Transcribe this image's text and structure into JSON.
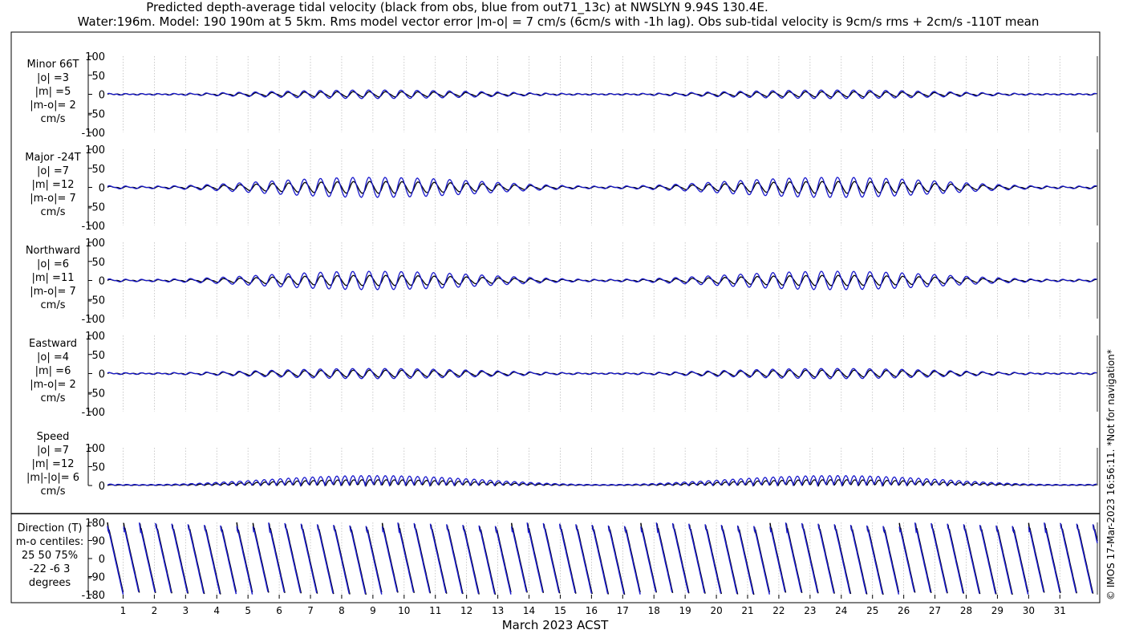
{
  "title": {
    "line1": "Predicted depth-average tidal velocity (black from obs, blue from out71_13c) at NWSLYN 9.94S 130.4E.",
    "line2": "Water:196m. Model: 190 190m at 5 5km. Rms model vector error |m-o| = 7 cm/s (6cm/s with -1h lag). Obs sub-tidal velocity is 9cm/s rms + 2cm/s -110T mean"
  },
  "xlabel": "March 2023 ACST",
  "side_note": "© IMOS 17-Mar-2023 16:56:11. *Not for navigation*",
  "colors": {
    "obs": "#000000",
    "model": "#1a1acc",
    "grid": "#b4b4b4"
  },
  "chart_data": [
    {
      "type": "line",
      "key": "minor",
      "label_lines": [
        "Minor 66T",
        "|o| =3",
        "|m| =5",
        "|m-o|= 2",
        "cm/s"
      ],
      "yticks": [
        "100",
        "50",
        "0",
        "-50",
        "-100"
      ],
      "ylim": [
        -100,
        100
      ],
      "x": {
        "range": [
          0,
          31.7
        ],
        "ticks": [
          1,
          31
        ]
      },
      "series": [
        {
          "role": "obs",
          "amplitude": 3
        },
        {
          "role": "model",
          "amplitude": 5
        }
      ]
    },
    {
      "type": "line",
      "key": "major",
      "label_lines": [
        "Major -24T",
        "|o| =7",
        "|m| =12",
        "|m-o|= 7",
        "cm/s"
      ],
      "yticks": [
        "100",
        "50",
        "0",
        "-50",
        "-100"
      ],
      "ylim": [
        -100,
        100
      ],
      "series": [
        {
          "role": "obs",
          "amplitude": 7
        },
        {
          "role": "model",
          "amplitude": 12
        }
      ]
    },
    {
      "type": "line",
      "key": "north",
      "label_lines": [
        "Northward",
        "|o| =6",
        "|m| =11",
        "|m-o|= 7",
        "cm/s"
      ],
      "yticks": [
        "100",
        "50",
        "0",
        "-50",
        "-100"
      ],
      "ylim": [
        -100,
        100
      ],
      "series": [
        {
          "role": "obs",
          "amplitude": 6
        },
        {
          "role": "model",
          "amplitude": 11
        }
      ]
    },
    {
      "type": "line",
      "key": "east",
      "label_lines": [
        "Eastward",
        "|o| =4",
        "|m| =6",
        "|m-o|= 2",
        "cm/s"
      ],
      "yticks": [
        "100",
        "50",
        "0",
        "-50",
        "-100"
      ],
      "ylim": [
        -100,
        100
      ],
      "series": [
        {
          "role": "obs",
          "amplitude": 4
        },
        {
          "role": "model",
          "amplitude": 6
        }
      ]
    },
    {
      "type": "line",
      "key": "speed",
      "label_lines": [
        "Speed",
        "|o| =7",
        "|m| =12",
        "|m|-|o|= 6",
        "cm/s"
      ],
      "yticks": [
        "100",
        "50",
        "0"
      ],
      "ylim": [
        0,
        100
      ],
      "series": [
        {
          "role": "obs",
          "amplitude": 7
        },
        {
          "role": "model",
          "amplitude": 12
        }
      ]
    },
    {
      "type": "line",
      "key": "direction",
      "label_lines": [
        "Direction (T)",
        "m-o centiles:",
        "25  50  75%",
        "-22  -6   3",
        "degrees"
      ],
      "yticks": [
        "180",
        "90",
        "0",
        "-90",
        "-180"
      ],
      "ylim": [
        -180,
        180
      ],
      "series": [
        {
          "role": "obs"
        },
        {
          "role": "model"
        }
      ]
    }
  ],
  "xticks": [
    "1",
    "2",
    "3",
    "4",
    "5",
    "6",
    "7",
    "8",
    "9",
    "10",
    "11",
    "12",
    "13",
    "14",
    "15",
    "16",
    "17",
    "18",
    "19",
    "20",
    "21",
    "22",
    "23",
    "24",
    "25",
    "26",
    "27",
    "28",
    "29",
    "30",
    "31"
  ]
}
